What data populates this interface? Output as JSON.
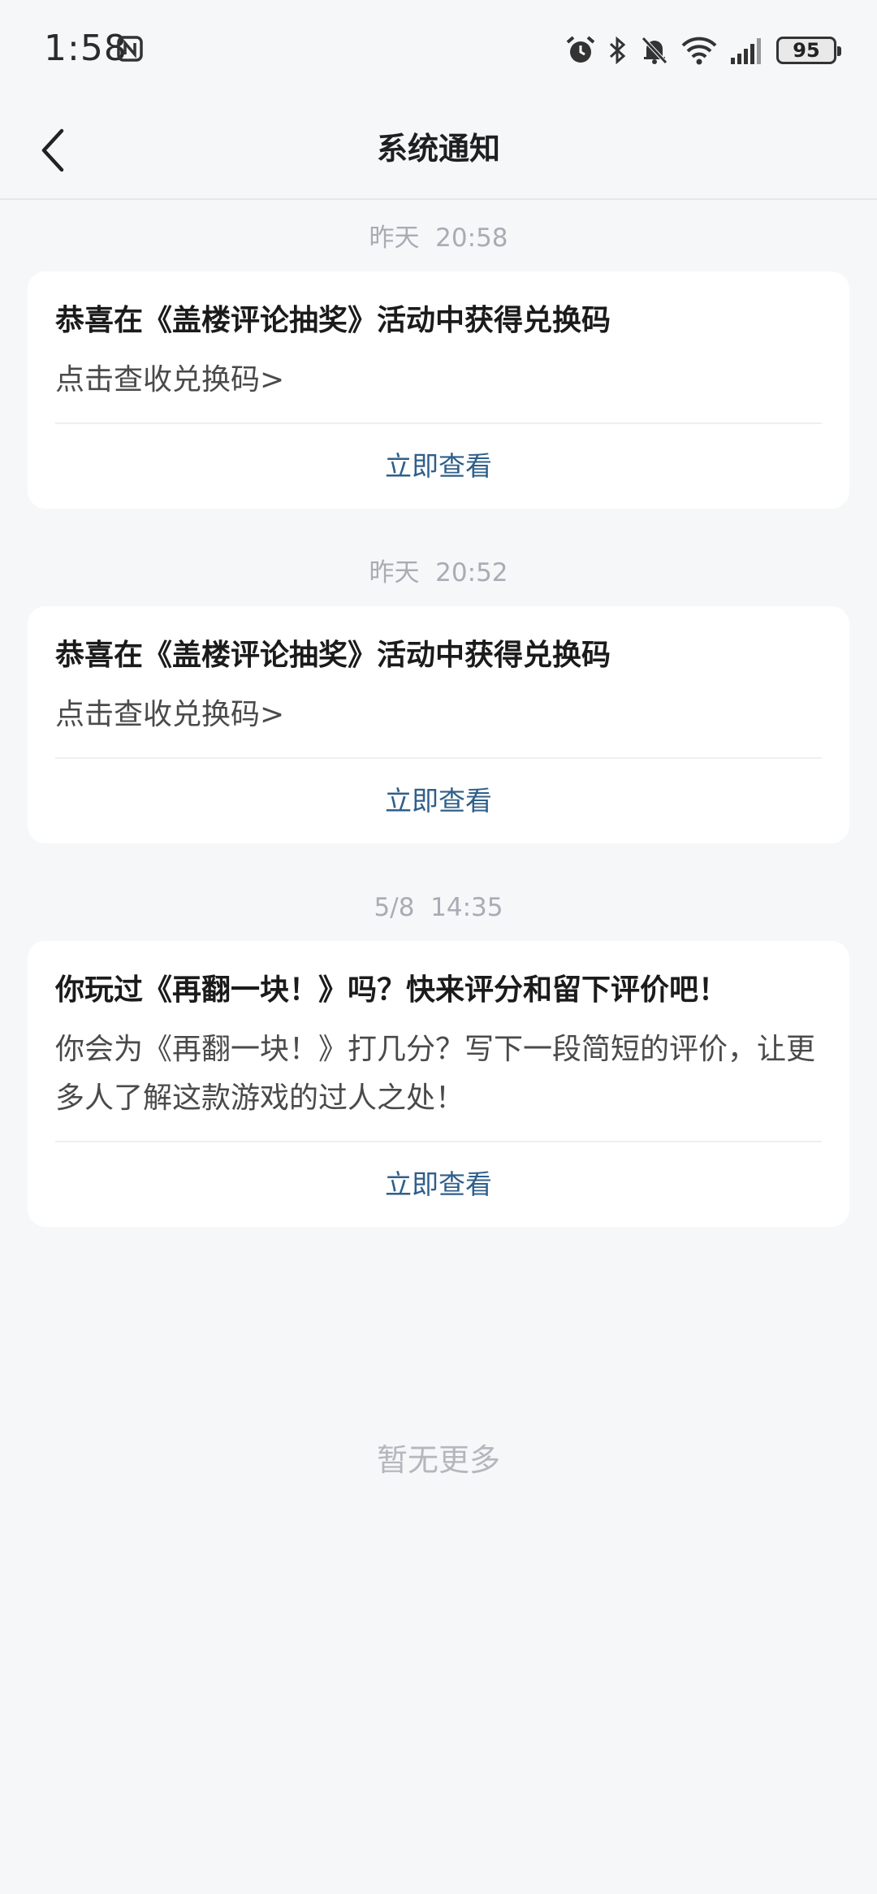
{
  "status_bar": {
    "time": "1:58",
    "battery": "95",
    "icons": [
      "nfc-icon",
      "alarm-icon",
      "bluetooth-icon",
      "mute-bell-icon",
      "wifi-icon",
      "signal-icon",
      "battery-icon"
    ]
  },
  "header": {
    "title": "系统通知",
    "back_icon": "chevron-left-icon"
  },
  "notifications": [
    {
      "time": "昨天  20:58",
      "title": "恭喜在《盖楼评论抽奖》活动中获得兑换码",
      "body": "点击查收兑换码>",
      "action": "立即查看"
    },
    {
      "time": "昨天  20:52",
      "title": "恭喜在《盖楼评论抽奖》活动中获得兑换码",
      "body": "点击查收兑换码>",
      "action": "立即查看"
    },
    {
      "time": "5/8  14:35",
      "title": "你玩过《再翻一块！》吗？快来评分和留下评价吧！",
      "body": "你会为《再翻一块！》打几分？写下一段简短的评价，让更多人了解这款游戏的过人之处！",
      "action": "立即查看"
    }
  ],
  "footer": {
    "no_more": "暂无更多"
  },
  "colors": {
    "background": "#f6f7f9",
    "card": "#ffffff",
    "action_link": "#2f5f8a",
    "timestamp": "#a8acb3"
  }
}
